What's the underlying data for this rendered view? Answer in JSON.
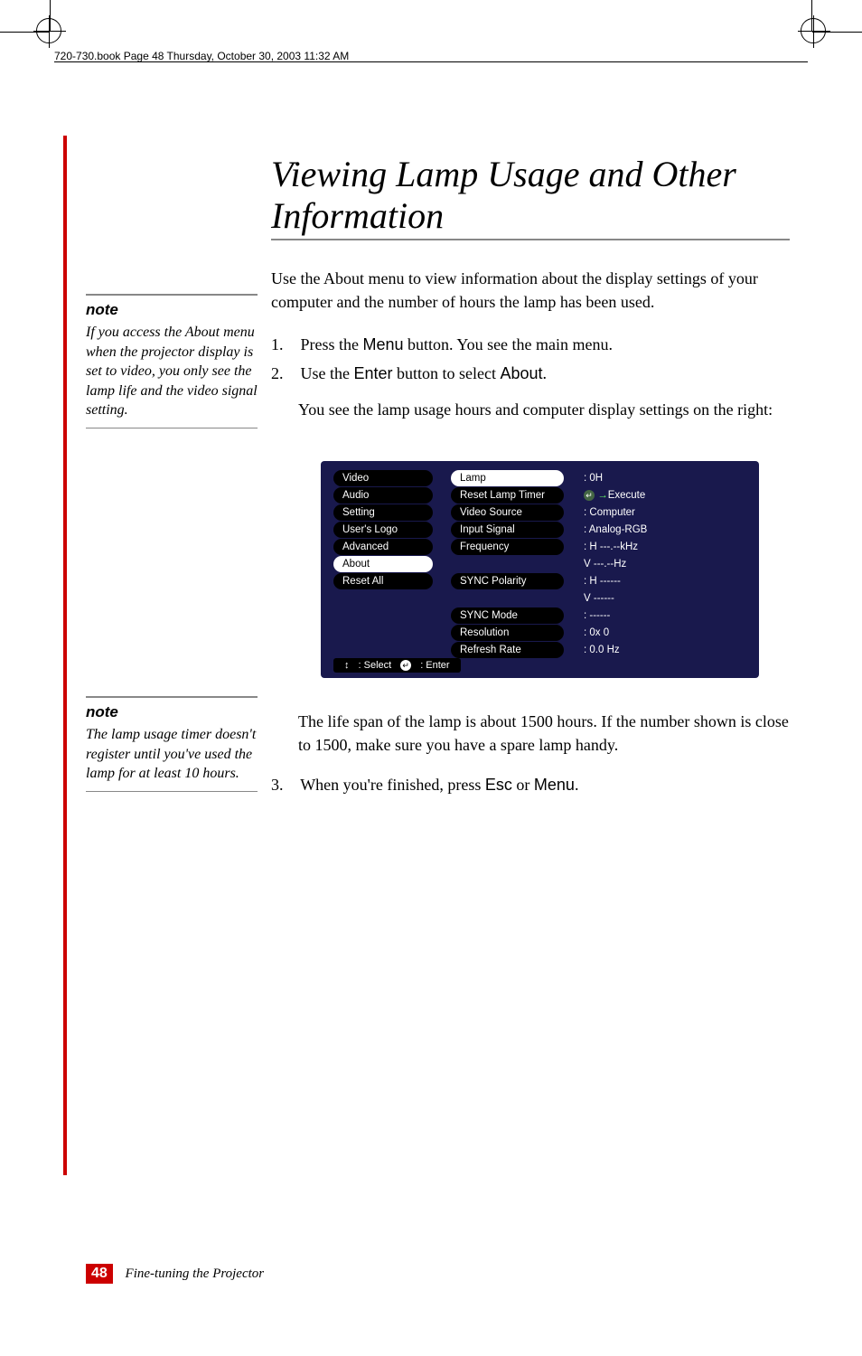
{
  "header": {
    "line": "720-730.book  Page 48  Thursday, October 30, 2003  11:32 AM"
  },
  "title": "Viewing Lamp Usage and Other Information",
  "intro": "Use the About menu to view information about the display settings of your computer and the number of hours the lamp has been used.",
  "steps": {
    "s1_num": "1.",
    "s1_a": "Press the ",
    "s1_b": "Menu",
    "s1_c": " button. You see the main menu.",
    "s2_num": "2.",
    "s2_a": "Use the ",
    "s2_b": "Enter",
    "s2_c": " button to select ",
    "s2_d": "About",
    "s2_e": ".",
    "s2_sub": "You see the lamp usage hours and computer display settings on the right:",
    "s3_num": "3.",
    "s3_a": "When you're finished, press ",
    "s3_b": "Esc",
    "s3_c": " or ",
    "s3_d": "Menu",
    "s3_e": "."
  },
  "after_osd": "The life span of the lamp is about 1500 hours. If the number shown is close to 1500, make sure you have a spare lamp handy.",
  "sidebar1": {
    "heading": "note",
    "body": "If you access the About menu when the projector display is set to video, you only see the lamp life and the video signal setting."
  },
  "sidebar2": {
    "heading": "note",
    "body": "The lamp usage timer doesn't register until you've used the lamp for at least 10 hours."
  },
  "osd": {
    "left": [
      "Video",
      "Audio",
      "Setting",
      "User's Logo",
      "Advanced",
      "About",
      "Reset All"
    ],
    "mid": [
      "Lamp",
      "Reset Lamp Timer",
      "Video Source",
      "Input Signal",
      "Frequency",
      "",
      "SYNC Polarity",
      "",
      "SYNC Mode",
      "Resolution",
      "Refresh Rate"
    ],
    "right_prefix_execute": "Execute",
    "right": [
      ":  0H",
      "",
      ":  Computer",
      ":  Analog-RGB",
      ":  H ---.--kHz",
      "   V ---.--Hz",
      ":  H ------",
      "   V ------",
      ":  ------",
      ":  0x    0",
      ":  0.0 Hz"
    ],
    "footer_select": ": Select",
    "footer_enter": ": Enter"
  },
  "footer": {
    "page": "48",
    "section": "Fine-tuning the Projector"
  }
}
